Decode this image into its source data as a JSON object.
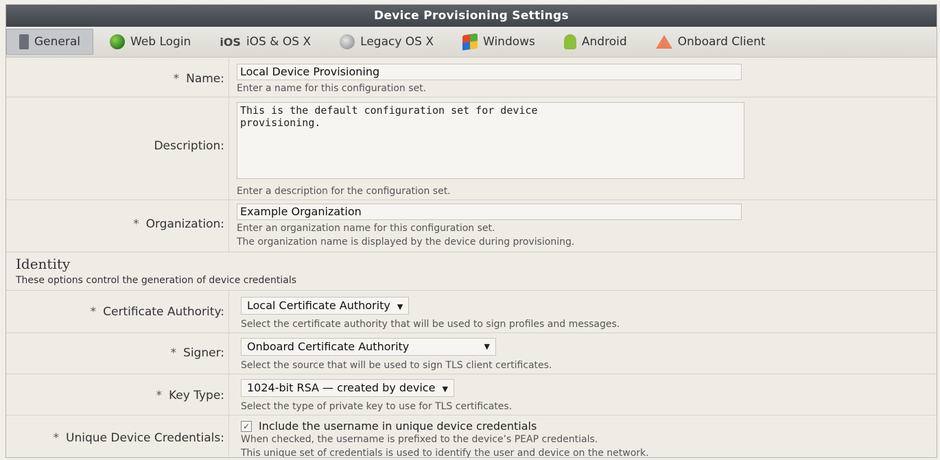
{
  "window": {
    "title": "Device Provisioning Settings"
  },
  "tabs": [
    {
      "label": "General",
      "icon": "device-icon",
      "active": true
    },
    {
      "label": "Web Login",
      "icon": "globe-icon"
    },
    {
      "label": "iOS & OS X",
      "icon": "ios-icon",
      "icon_text": "iOS"
    },
    {
      "label": "Legacy OS X",
      "icon": "apple-icon"
    },
    {
      "label": "Windows",
      "icon": "windows-icon"
    },
    {
      "label": "Android",
      "icon": "android-icon"
    },
    {
      "label": "Onboard Client",
      "icon": "onboard-icon"
    }
  ],
  "form": {
    "required_marker": "*",
    "name": {
      "label": "Name:",
      "value": "Local Device Provisioning",
      "hint": "Enter a name for this configuration set."
    },
    "description": {
      "label": "Description:",
      "value": "This is the default configuration set for device\nprovisioning.",
      "hint": "Enter a description for the configuration set."
    },
    "organization": {
      "label": "Organization:",
      "value": "Example Organization",
      "hint1": "Enter an organization name for this configuration set.",
      "hint2": "The organization name is displayed by the device during provisioning."
    }
  },
  "identity": {
    "title": "Identity",
    "subtitle": "These options control the generation of device credentials",
    "certificate_authority": {
      "label": "Certificate Authority:",
      "value": "Local Certificate Authority",
      "hint": "Select the certificate authority that will be used to sign profiles and messages."
    },
    "signer": {
      "label": "Signer:",
      "value": "Onboard Certificate Authority",
      "hint": "Select the source that will be used to sign TLS client certificates."
    },
    "key_type": {
      "label": "Key Type:",
      "value": "1024-bit RSA — created by device",
      "hint": "Select the type of private key to use for TLS certificates."
    },
    "unique_credentials": {
      "label": "Unique Device Credentials:",
      "checked": true,
      "check_label": "Include the username in unique device credentials",
      "hint1": "When checked, the username is prefixed to the device’s PEAP credentials.",
      "hint2": "This unique set of credentials is used to identify the user and device on the network."
    }
  }
}
